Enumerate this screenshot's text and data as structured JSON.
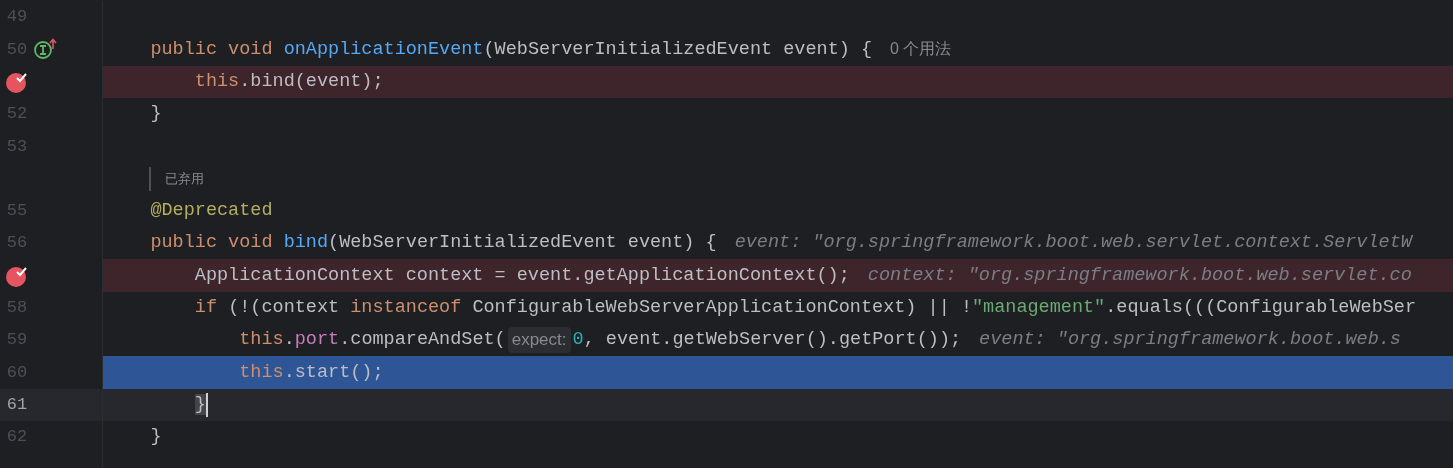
{
  "editor": {
    "lines": [
      {
        "number": "49",
        "kind": "code",
        "breakpoint": false,
        "selected": false,
        "current": false
      },
      {
        "number": "50",
        "kind": "code",
        "breakpoint": false,
        "selected": false,
        "current": false,
        "gutter_icon": {
          "kind": "implements"
        },
        "tokens": [
          {
            "text": "    public void ",
            "kind": "keyword"
          },
          {
            "text": "onApplicationEvent",
            "kind": "method"
          },
          {
            "text": "(WebServerInitializedEvent event) {",
            "kind": "plain"
          }
        ],
        "hint": {
          "kind": "usages",
          "text": "0 个用法"
        }
      },
      {
        "kind": "code",
        "breakpoint": true,
        "selected": false,
        "current": false,
        "tokens": [
          {
            "text": "        this",
            "kind": "keyword"
          },
          {
            "text": ".bind(event);",
            "kind": "plain"
          }
        ]
      },
      {
        "number": "52",
        "kind": "code",
        "breakpoint": false,
        "selected": false,
        "current": false,
        "tokens": [
          {
            "text": "    }",
            "kind": "plain"
          }
        ]
      },
      {
        "number": "53",
        "kind": "code",
        "breakpoint": false,
        "selected": false,
        "current": false
      },
      {
        "kind": "inlay",
        "text": "已弃用"
      },
      {
        "number": "55",
        "kind": "code",
        "breakpoint": false,
        "selected": false,
        "current": false,
        "tokens": [
          {
            "text": "    @Deprecated",
            "kind": "annotation"
          }
        ]
      },
      {
        "number": "56",
        "kind": "code",
        "breakpoint": false,
        "selected": false,
        "current": false,
        "tokens": [
          {
            "text": "    public void ",
            "kind": "keyword"
          },
          {
            "text": "bind",
            "kind": "method"
          },
          {
            "text": "(WebServerInitializedEvent event) {",
            "kind": "plain"
          }
        ],
        "hint": {
          "kind": "value",
          "text": "event: \"org.springframework.boot.web.servlet.context.ServletW"
        }
      },
      {
        "kind": "code",
        "breakpoint": true,
        "selected": false,
        "current": false,
        "tokens": [
          {
            "text": "        ApplicationContext context = event.getApplicationContext();",
            "kind": "plain"
          }
        ],
        "hint": {
          "kind": "value",
          "text": "context: \"org.springframework.boot.web.servlet.co"
        }
      },
      {
        "number": "58",
        "kind": "code",
        "breakpoint": false,
        "selected": false,
        "current": false,
        "tokens": [
          {
            "text": "        if",
            "kind": "keyword"
          },
          {
            "text": " (!(context ",
            "kind": "plain"
          },
          {
            "text": "instanceof",
            "kind": "keyword"
          },
          {
            "text": " ConfigurableWebServerApplicationContext) || !",
            "kind": "plain"
          },
          {
            "text": "\"management\"",
            "kind": "string"
          },
          {
            "text": ".equals(((ConfigurableWebSer",
            "kind": "plain"
          }
        ]
      },
      {
        "number": "59",
        "kind": "code",
        "breakpoint": false,
        "selected": false,
        "current": false,
        "tokens": [
          {
            "text": "            this",
            "kind": "keyword"
          },
          {
            "text": ".",
            "kind": "plain"
          },
          {
            "text": "port",
            "kind": "field"
          },
          {
            "text": ".compareAndSet(",
            "kind": "plain"
          },
          {
            "text": "expect:",
            "kind": "param_hint"
          },
          {
            "text": "0",
            "kind": "number"
          },
          {
            "text": ", event.getWebServer().getPort());",
            "kind": "plain"
          }
        ],
        "hint": {
          "kind": "value",
          "text": "event: \"org.springframework.boot.web.s"
        }
      },
      {
        "number": "60",
        "kind": "code",
        "breakpoint": false,
        "selected": true,
        "current": false,
        "tokens": [
          {
            "text": "            this",
            "kind": "keyword"
          },
          {
            "text": ".start();",
            "kind": "plain"
          }
        ]
      },
      {
        "number": "61",
        "kind": "code",
        "breakpoint": false,
        "selected": false,
        "current": true,
        "tokens": [
          {
            "text": "        }",
            "kind": "brace_match"
          }
        ]
      },
      {
        "number": "62",
        "kind": "code",
        "breakpoint": false,
        "selected": false,
        "current": false,
        "tokens": [
          {
            "text": "    }",
            "kind": "plain"
          }
        ]
      }
    ]
  }
}
